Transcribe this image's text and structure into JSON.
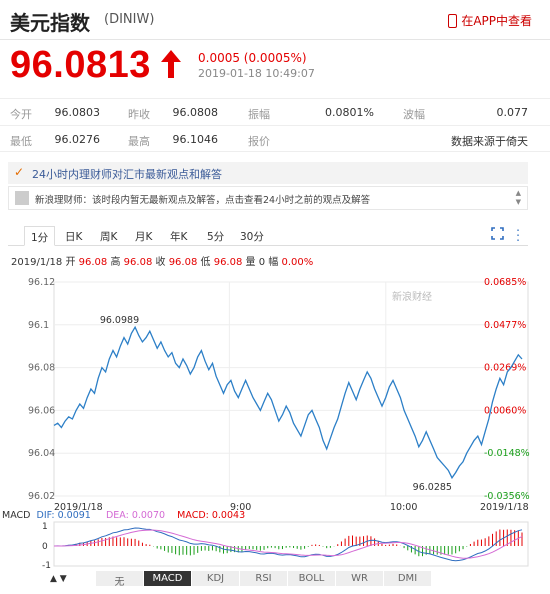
{
  "header": {
    "title": "美元指数",
    "code": "(DINIW)",
    "app_link": "在APP中查看"
  },
  "quote": {
    "price": "96.0813",
    "change": "0.0005 (0.0005%)",
    "timestamp": "2019-01-18 10:49:07"
  },
  "stats": {
    "row1": [
      {
        "label": "今开",
        "value": "96.0803"
      },
      {
        "label": "昨收",
        "value": "96.0808"
      },
      {
        "label": "振幅",
        "value": "0.0801%"
      },
      {
        "label": "波幅",
        "value": "0.077"
      }
    ],
    "row2": [
      {
        "label": "最低",
        "value": "96.0276"
      },
      {
        "label": "最高",
        "value": "96.1046"
      },
      {
        "label": "报价",
        "value": "数据来源于倚天"
      }
    ]
  },
  "notice": "24小时内理财师对汇市最新观点和解答",
  "news": "新浪理财师：该时段内暂无最新观点及解答，点击查看24小时之前的观点及解答",
  "tabs": [
    "1分",
    "日K",
    "周K",
    "月K",
    "年K",
    "5分",
    "30分"
  ],
  "infoline": {
    "date": "2019/1/18",
    "open_label": "开",
    "open": "96.08",
    "high_label": "高",
    "high": "96.08",
    "close_label": "收",
    "close": "96.08",
    "low_label": "低",
    "low": "96.08",
    "vol_label": "量",
    "vol": "0",
    "chg_label": "幅",
    "chg": "0.00%"
  },
  "watermark": "新浪财经",
  "chart_data": {
    "type": "line",
    "yticks": [
      "96.12",
      "96.1",
      "96.08",
      "96.06",
      "96.04",
      "96.02"
    ],
    "pct_ticks": [
      "0.0685%",
      "0.0477%",
      "0.0269%",
      "0.0060%",
      "-0.0148%",
      "-0.0356%"
    ],
    "xticks": [
      "2019/1/18",
      "9:00",
      "10:00",
      "2019/1/18"
    ],
    "ylim": [
      96.02,
      96.12
    ],
    "annotations": [
      {
        "label": "96.0989",
        "x": 0.16,
        "y": 96.0989
      },
      {
        "label": "96.0285",
        "x": 0.82,
        "y": 96.0285
      }
    ],
    "series": [
      {
        "values": [
          96.053,
          96.054,
          96.052,
          96.055,
          96.057,
          96.056,
          96.06,
          96.063,
          96.061,
          96.066,
          96.07,
          96.068,
          96.075,
          96.08,
          96.078,
          96.084,
          96.088,
          96.085,
          96.09,
          96.094,
          96.091,
          96.096,
          96.0989,
          96.095,
          96.092,
          96.094,
          96.097,
          96.093,
          96.089,
          96.092,
          96.088,
          96.085,
          96.087,
          96.082,
          96.08,
          96.084,
          96.081,
          96.077,
          96.08,
          96.085,
          96.088,
          96.083,
          96.079,
          96.082,
          96.076,
          96.072,
          96.068,
          96.072,
          96.074,
          96.069,
          96.066,
          96.07,
          96.074,
          96.07,
          96.066,
          96.063,
          96.06,
          96.064,
          96.068,
          96.065,
          96.06,
          96.055,
          96.058,
          96.062,
          96.059,
          96.054,
          96.051,
          96.048,
          96.053,
          96.058,
          96.06,
          96.056,
          96.052,
          96.046,
          96.042,
          96.047,
          96.052,
          96.056,
          96.062,
          96.068,
          96.073,
          96.069,
          96.065,
          96.07,
          96.074,
          96.078,
          96.075,
          96.07,
          96.066,
          96.062,
          96.066,
          96.071,
          96.074,
          96.07,
          96.066,
          96.06,
          96.056,
          96.052,
          96.048,
          96.043,
          96.046,
          96.05,
          96.046,
          96.042,
          96.038,
          96.036,
          96.034,
          96.032,
          96.0285,
          96.031,
          96.034,
          96.036,
          96.04,
          96.043,
          96.046,
          96.048,
          96.044,
          96.05,
          96.056,
          96.064,
          96.07,
          96.075,
          96.072,
          96.078,
          96.08,
          96.083,
          96.086,
          96.084
        ]
      }
    ]
  },
  "macd": {
    "label": "MACD",
    "dif": "DIF: 0.0091",
    "dea": "DEA: 0.0070",
    "macd": "MACD: 0.0043",
    "yticks": [
      "1",
      "0",
      "-1"
    ]
  },
  "indicators": [
    "无",
    "MACD",
    "KDJ",
    "RSI",
    "BOLL",
    "WR",
    "DMI"
  ]
}
